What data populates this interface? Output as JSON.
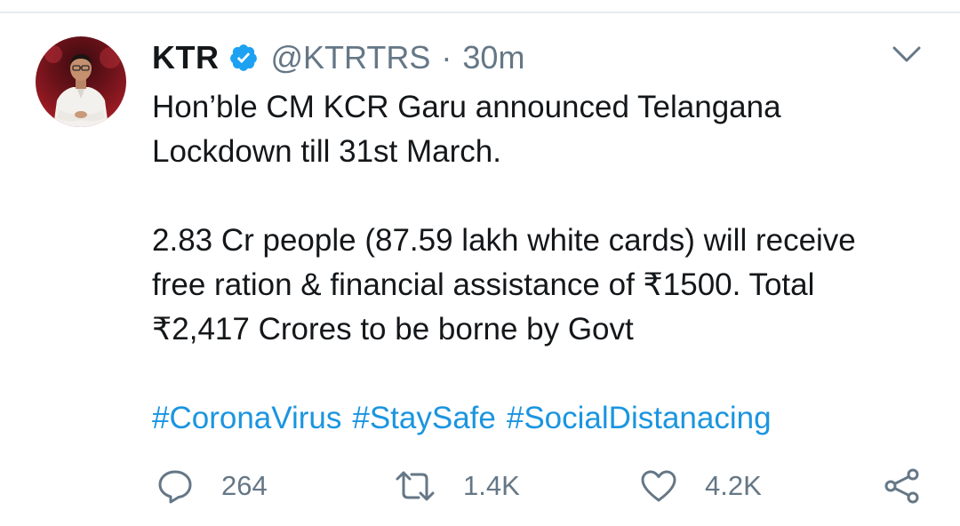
{
  "tweet": {
    "author": {
      "display_name": "KTR",
      "verified": true,
      "handle": "@KTRTRS",
      "separator": "·",
      "time": "30m"
    },
    "body": {
      "line1": "Hon’ble CM KCR Garu announced Telangana",
      "line2": "Lockdown till 31st March.",
      "para2_line1": "2.83 Cr people (87.59 lakh white cards) will receive",
      "para2_line2": "free ration & financial assistance of ₹1500. Total",
      "para2_line3": "₹2,417 Crores to be borne by Govt"
    },
    "hashtags": [
      "#CoronaVirus",
      "#StaySafe",
      "#SocialDistanacing"
    ],
    "actions": {
      "replies": "264",
      "retweets": "1.4K",
      "likes": "4.2K"
    }
  },
  "colors": {
    "text_primary": "#14171a",
    "text_secondary": "#657786",
    "link": "#1b95e0",
    "verified_badge": "#1da1f2"
  },
  "icons": [
    "verified-icon",
    "chevron-down-icon",
    "reply-icon",
    "retweet-icon",
    "like-icon",
    "share-icon"
  ]
}
